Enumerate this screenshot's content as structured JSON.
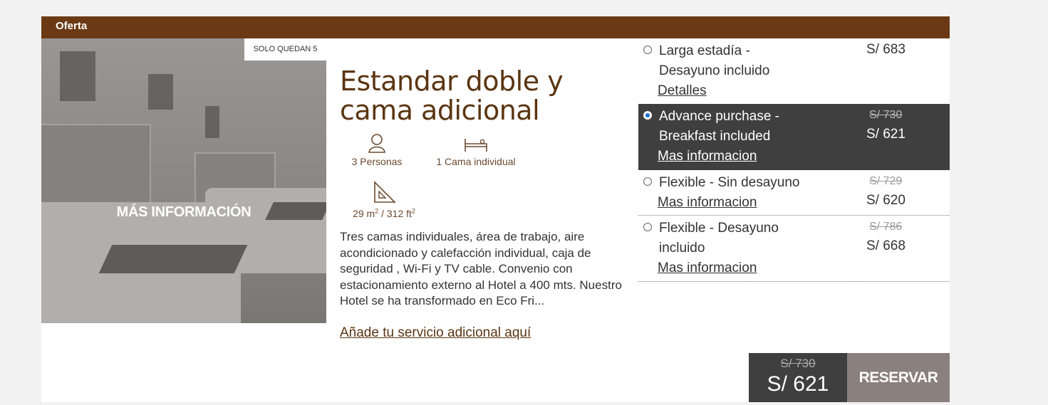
{
  "offer": {
    "label": "Oferta"
  },
  "room": {
    "badge": "SOLO QUEDAN 5",
    "photo_link": "MÁS INFORMACIÓN",
    "title": "Estandar doble y cama adicional",
    "amenities": {
      "persons_icon": "person-icon",
      "persons": "3 Personas",
      "bed_icon": "bed-icon",
      "bed": "1 Cama individual",
      "area_icon": "set-square-icon",
      "area_m": "29 m",
      "area_m_sup": "2",
      "area_sep": " / 312 ft",
      "area_ft_sup": "2"
    },
    "description": "Tres camas individuales, área de trabajo, aire acondicionado y calefacción individual, caja de seguridad , Wi-Fi y TV cable. Convenio con estacionamiento externo al Hotel a 400 mts. Nuestro Hotel se ha transformado en Eco Fri...",
    "addon_link": "Añade tu servicio adicional aquí"
  },
  "rates": [
    {
      "name_line1": "Larga estadía -",
      "name_line2": "Desayuno incluido",
      "link": "Detalles",
      "old_price": "",
      "price": "S/ 683",
      "selected": false
    },
    {
      "name_line1": "Advance purchase -",
      "name_line2": "Breakfast included",
      "link": "Mas informacion",
      "old_price": "S/ 730",
      "price": "S/ 621",
      "selected": true
    },
    {
      "name_line1": "Flexible - Sin desayuno",
      "name_line2": "",
      "link": "Mas informacion",
      "old_price": "S/ 729",
      "price": "S/ 620",
      "selected": false
    },
    {
      "name_line1": "Flexible - Desayuno",
      "name_line2": "incluido",
      "link": "Mas informacion",
      "old_price": "S/ 786",
      "price": "S/ 668",
      "selected": false
    }
  ],
  "total": {
    "old_price": "S/ 730",
    "price": "S/ 621"
  },
  "reserve_label": "RESERVAR",
  "colors": {
    "brand": "#6b3a15",
    "title": "#5a3512",
    "selected_rate_bg": "#3f3f3f",
    "reserve_bg": "#8a807d"
  }
}
